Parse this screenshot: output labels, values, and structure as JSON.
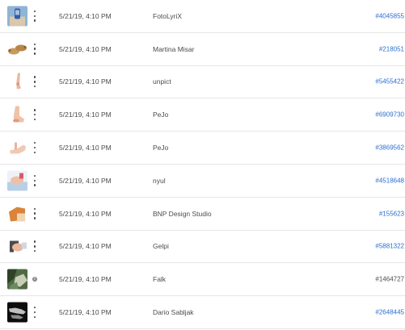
{
  "rows": [
    {
      "date": "5/21/19, 4:10 PM",
      "author": "FotoLyriX",
      "id": "#4045855",
      "id_link": true,
      "action": "more-icon",
      "thumb": "blue-bottle"
    },
    {
      "date": "5/21/19, 4:10 PM",
      "author": "Martina Misar",
      "id": "#218051",
      "id_link": true,
      "action": "more-icon",
      "thumb": "feet-pair"
    },
    {
      "date": "5/21/19, 4:10 PM",
      "author": "unpict",
      "id": "#5455422",
      "id_link": true,
      "action": "more-icon",
      "thumb": "leg"
    },
    {
      "date": "5/21/19, 4:10 PM",
      "author": "PeJo",
      "id": "#6909730",
      "id_link": true,
      "action": "more-icon",
      "thumb": "foot-heel"
    },
    {
      "date": "5/21/19, 4:10 PM",
      "author": "PeJo",
      "id": "#3869562",
      "id_link": true,
      "action": "more-icon",
      "thumb": "foot-side"
    },
    {
      "date": "5/21/19, 4:10 PM",
      "author": "nyul",
      "id": "#4518648",
      "id_link": true,
      "action": "more-icon",
      "thumb": "massage"
    },
    {
      "date": "5/21/19, 4:10 PM",
      "author": "BNP Design Studio",
      "id": "#155623",
      "id_link": true,
      "action": "more-icon",
      "thumb": "feet-bottom"
    },
    {
      "date": "5/21/19, 4:10 PM",
      "author": "Gelpi",
      "id": "#5881322",
      "id_link": true,
      "action": "more-icon",
      "thumb": "shoe"
    },
    {
      "date": "5/21/19, 4:10 PM",
      "author": "Falk",
      "id": "#1464727",
      "id_link": false,
      "action": "info-icon",
      "thumb": "mossy"
    },
    {
      "date": "5/21/19, 4:10 PM",
      "author": "Dario Sabljak",
      "id": "#2648445",
      "id_link": true,
      "action": "more-icon",
      "thumb": "xray"
    }
  ],
  "colors": {
    "link": "#2c6fd1",
    "text": "#4b4b4b",
    "divider": "#e6e6e6"
  }
}
